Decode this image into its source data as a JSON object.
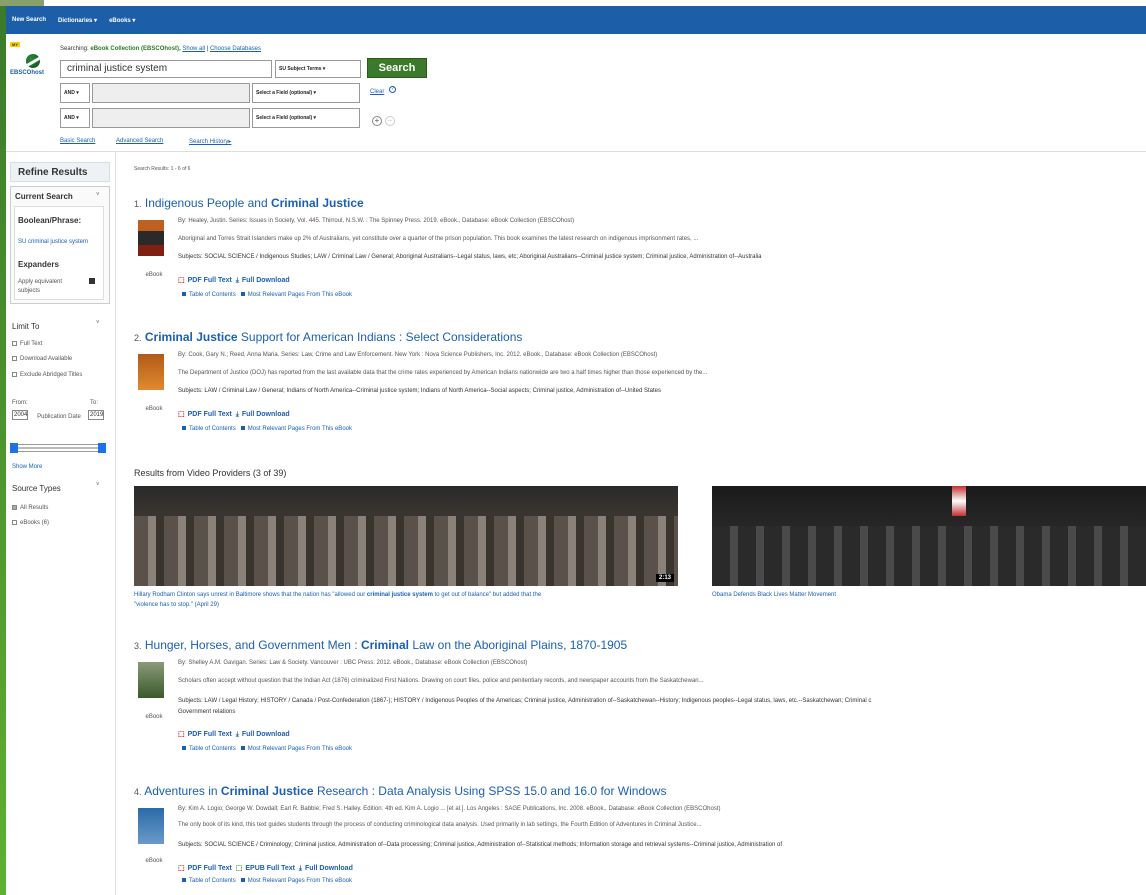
{
  "topbar": {
    "items": [
      "New Search",
      "Dictionaries",
      "eBooks"
    ]
  },
  "logo": {
    "badge": "MY",
    "text": "EBSCOhost"
  },
  "search": {
    "searching_label": "Searching:",
    "database": "eBook Collection (EBSCOhost),",
    "show_all": "Show all",
    "choose_db": "Choose Databases",
    "query": "criminal justice system",
    "field1": "SU Subject Terms",
    "bool2": "AND",
    "bool3": "AND",
    "field2": "Select a Field (optional)",
    "field3": "Select a Field (optional)",
    "button": "Search",
    "clear": "Clear",
    "links": [
      "Basic Search",
      "Advanced Search",
      "Search History"
    ]
  },
  "sidebar": {
    "refine": "Refine Results",
    "current_search": "Current Search",
    "boolean_phrase": "Boolean/Phrase:",
    "boolean_value": "SU criminal justice system",
    "expanders": "Expanders",
    "expander_value": "Apply equivalent subjects",
    "limit_to": "Limit To",
    "limits": [
      "Full Text",
      "Download Available",
      "Exclude Abridged Titles"
    ],
    "from_label": "From:",
    "to_label": "To:",
    "from_year": "2004",
    "to_year": "2019",
    "pub_date": "Publication Date",
    "show_more": "Show More",
    "source_types": "Source Types",
    "sources": [
      "All Results",
      "eBooks (6)"
    ]
  },
  "main": {
    "count": "Search Results: 1 - 6 of 6",
    "results": [
      {
        "num": "1.",
        "title_a": "Indigenous People and ",
        "title_b": "Criminal Justice",
        "title_c": "",
        "by": "By: Healey, Justin. Series: Issues in Society, Vol. 445. Thirroul, N.S.W. : The Spinney Press. 2019. eBook., Database: eBook Collection (EBSCOhost)",
        "abstract": "Aboriginal and Torres Strait Islanders make up 2% of Australians, yet constitute over a quarter of the prison population. This book examines the latest research on indigenous imprisonment rates, ...",
        "subjects": "Subjects: SOCIAL SCIENCE / Indigenous Studies; LAW / Criminal Law / General; Aboriginal Australians--Legal status, laws, etc; Aboriginal Australians--Criminal justice system; Criminal justice, Administration of--Australia",
        "kind": "eBook",
        "pdf": "PDF Full Text",
        "epub": "",
        "full": "Full Download",
        "toc": "Table of Contents",
        "pages": "Most Relevant Pages From This eBook"
      },
      {
        "num": "2.",
        "title_a": "",
        "title_b": "Criminal Justice",
        "title_c": " Support for American Indians : Select Considerations",
        "by": "By: Cook, Gary N.; Reed, Anna Maria. Series: Law, Crime and Law Enforcement. New York : Nova Science Publishers, Inc. 2012. eBook., Database: eBook Collection (EBSCOhost)",
        "abstract": "The Department of Justice (DOJ) has reported from the last available data that the crime rates experienced by American Indians nationwide are two a half times higher than those experienced by the...",
        "subjects": "Subjects: LAW / Criminal Law / General; Indians of North America--Criminal justice system; Indians of North America--Social aspects; Criminal justice, Administration of--United States",
        "kind": "eBook",
        "pdf": "PDF Full Text",
        "epub": "",
        "full": "Full Download",
        "toc": "Table of Contents",
        "pages": "Most Relevant Pages From This eBook"
      },
      {
        "num": "3.",
        "title_a": "Hunger, Horses, and Government Men : ",
        "title_b": "Criminal",
        "title_c": " Law on the Aboriginal Plains, 1870-1905",
        "by": "By: Shelley A.M. Gavigan. Series: Law & Society. Vancouver : UBC Press. 2012. eBook., Database: eBook Collection (EBSCOhost)",
        "abstract": "Scholars often accept without question that the Indian Act (1876) criminalized First Nations. Drawing on court files, police and penitentiary records, and newspaper accounts from the Saskatchewan...",
        "subjects": "Subjects: LAW / Legal History; HISTORY / Canada / Post-Confederation (1867-); HISTORY / Indigenous Peoples of the Americas; Criminal justice, Administration of--Saskatchewan--History; Indigenous peoples--Legal status, laws, etc.--Saskatchewan; Criminal c",
        "subjects2": "Government relations",
        "kind": "eBook",
        "pdf": "PDF Full Text",
        "epub": "",
        "full": "Full Download",
        "toc": "Table of Contents",
        "pages": "Most Relevant Pages From This eBook"
      },
      {
        "num": "4.",
        "title_a": "Adventures in ",
        "title_b": "Criminal Justice",
        "title_c": " Research : Data Analysis Using SPSS 15.0 and 16.0 for Windows",
        "by": "By: Kim A. Logio; George W. Dowdall; Earl R. Babbie; Fred S. Halley. Edition: 4th ed. Kim A. Logio ... [et al.]. Los Angeles : SAGE Publications, Inc. 2008. eBook., Database: eBook Collection (EBSCOhost)",
        "abstract": "The only book of its kind, this text guides students through the process of conducting criminological data analysis. Used primarily in lab settings, the Fourth Edition of Adventures in Criminal Justice...",
        "subjects": "Subjects: SOCIAL SCIENCE / Criminology; Criminal justice, Administration of--Data processing; Criminal justice, Administration of--Statistical methods; Information storage and retrieval systems--Criminal justice, Administration of",
        "kind": "eBook",
        "pdf": "PDF Full Text",
        "epub": "EPUB Full Text",
        "full": "Full Download",
        "toc": "Table of Contents",
        "pages": "Most Relevant Pages From This eBook"
      }
    ],
    "videos": {
      "heading": "Results from Video Providers (3 of 39)",
      "v1_duration": "2:13",
      "v1_caption_a": "Hillary Rodham Clinton says unrest in Baltimore shows that the nation has \"allowed our ",
      "v1_caption_b": "criminal justice system",
      "v1_caption_c": " to get out of balance\" but added that the",
      "v1_caption_d": "\"violence has to stop.\" (April 29)",
      "v2_caption": "Obama Defends Black Lives Matter Movement"
    }
  }
}
